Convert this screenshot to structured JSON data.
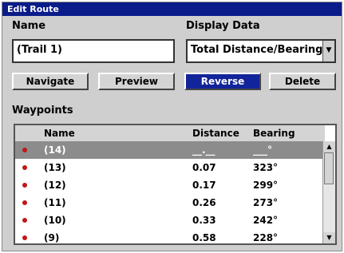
{
  "window": {
    "title": "Edit Route"
  },
  "name_field": {
    "label": "Name",
    "value": "(Trail 1)"
  },
  "display_data": {
    "label": "Display Data",
    "value": "Total Distance/Bearing",
    "arrow": "▼"
  },
  "buttons": {
    "navigate": "Navigate",
    "preview": "Preview",
    "reverse": "Reverse",
    "delete": "Delete"
  },
  "waypoints": {
    "label": "Waypoints",
    "headers": {
      "name": "Name",
      "distance": "Distance",
      "bearing": "Bearing"
    },
    "rows": [
      {
        "name": "(14)",
        "distance": "__.__",
        "bearing": "___°"
      },
      {
        "name": "(13)",
        "distance": "0.07",
        "bearing": "323°"
      },
      {
        "name": "(12)",
        "distance": "0.17",
        "bearing": "299°"
      },
      {
        "name": "(11)",
        "distance": "0.26",
        "bearing": "273°"
      },
      {
        "name": "(10)",
        "distance": "0.33",
        "bearing": "242°"
      },
      {
        "name": "(9)",
        "distance": "0.58",
        "bearing": "228°"
      }
    ],
    "scroll_up": "▲",
    "scroll_down": "▼"
  },
  "colors": {
    "title_bar": "#0a1c8a",
    "selected_button": "#12249a",
    "waypoint_marker": "#c01818"
  }
}
